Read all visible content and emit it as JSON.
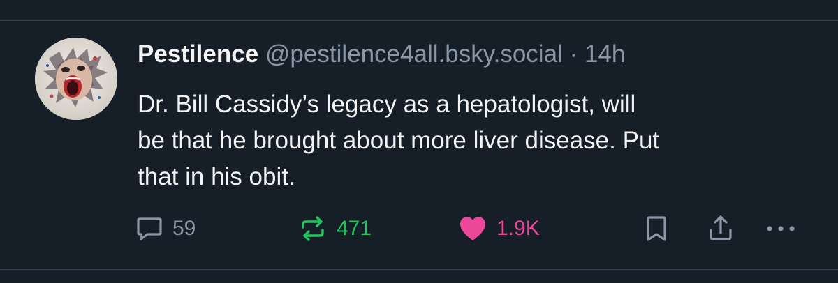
{
  "post": {
    "author": {
      "display_name": "Pestilence",
      "handle": "@pestilence4all.bsky.social"
    },
    "separator": "·",
    "timestamp": "14h",
    "text_lines": [
      "Dr. Bill Cassidy’s legacy as a hepatologist, will",
      "be that he brought about more liver disease. Put",
      "that in his obit."
    ],
    "actions": {
      "replies": "59",
      "reposts": "471",
      "likes": "1.9K"
    },
    "liked": true
  },
  "icons": {
    "reply": "reply-bubble-icon",
    "repost": "repost-arrows-icon",
    "like": "heart-icon",
    "bookmark": "bookmark-icon",
    "share": "share-upload-icon",
    "more": "more-dots-icon"
  },
  "colors": {
    "background": "#161e27",
    "text": "#f1f3f5",
    "muted": "#8a97a8",
    "repost": "#22c55e",
    "like": "#ec4899"
  }
}
